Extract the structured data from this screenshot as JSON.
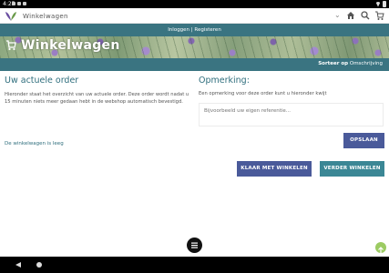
{
  "status_bar": {
    "time": "4:25"
  },
  "search_bar": {
    "placeholder": "Winkelwagen",
    "value": "Winkelwagen"
  },
  "login_bar": {
    "login": "Inloggen",
    "separator": " | ",
    "register": "Registeren"
  },
  "hero": {
    "title": "Winkelwagen"
  },
  "sort_bar": {
    "label": "Sorteer op",
    "value": "Omschrijving"
  },
  "order": {
    "heading": "Uw actuele order",
    "intro": "Hieronder staat het overzicht van uw actuele order. Deze order wordt nadat u 15 minuten niets meer gedaan hebt in de webshop automatisch bevestigd.",
    "empty": "De winkelwagen is leeg"
  },
  "remark": {
    "heading": "Opmerking:",
    "text": "Een opmerking voor deze order kunt u hieronder kwijt",
    "placeholder": "Bijvoorbeeld uw eigen referentie...",
    "save_label": "OPSLAAN"
  },
  "actions": {
    "done_label": "KLAAR MET WINKELEN",
    "continue_label": "VERDER WINKELEN"
  },
  "icons": {
    "logo": "leaf-logo-icon",
    "home": "home-icon",
    "search": "search-icon",
    "cart": "cart-icon",
    "menu": "menu-icon",
    "scroll_top": "arrow-up-icon",
    "back": "back-icon",
    "nav_home": "home-circle-icon"
  },
  "colors": {
    "accent": "#3a7481",
    "button_primary": "#4a5a9a",
    "button_secondary": "#3b8795",
    "heading": "#2f6e7d"
  }
}
